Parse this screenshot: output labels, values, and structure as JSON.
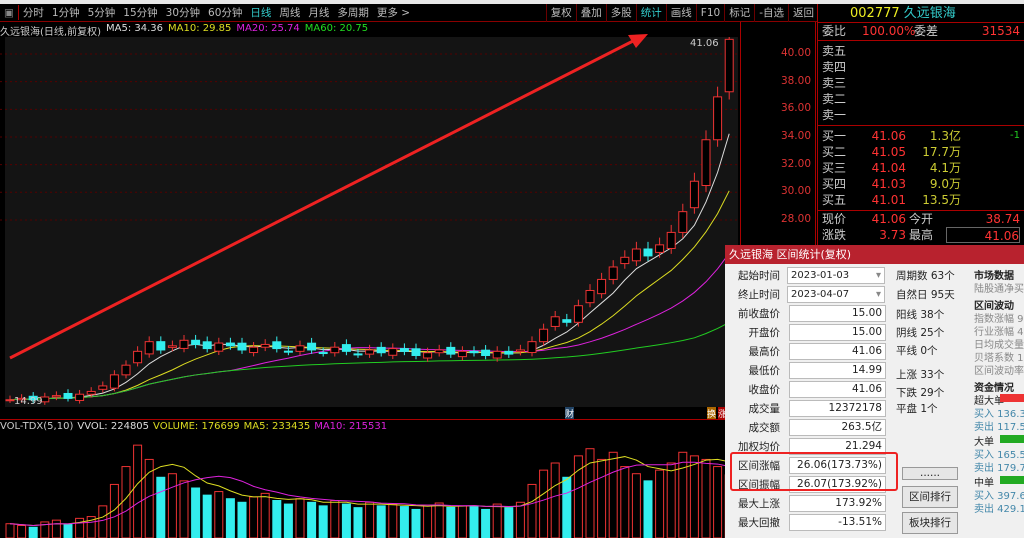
{
  "toolbar": {
    "periods": [
      "分时",
      "1分钟",
      "5分钟",
      "15分钟",
      "30分钟",
      "60分钟",
      "日线",
      "周线",
      "月线",
      "多周期",
      "更多 >"
    ],
    "active": "日线",
    "tools": [
      "复权",
      "叠加",
      "多股",
      "统计",
      "画线",
      "F10",
      "标记",
      "-自选",
      "返回"
    ],
    "active_tool": "统计"
  },
  "info": {
    "title": "久远银海(日线,前复权)",
    "ma5": "MA5: 34.36",
    "ma10": "MA10: 29.85",
    "ma20": "MA20: 25.74",
    "ma60": "MA60: 20.75"
  },
  "axis_ticks": [
    "40.00",
    "38.00",
    "36.00",
    "34.00",
    "32.00",
    "30.00",
    "28.00"
  ],
  "high_label": "41.06",
  "low_label": "14.99",
  "vol_info": {
    "name": "VOL-TDX(5,10)",
    "vvol": "VVOL: 224805",
    "volume": "VOLUME: 176699",
    "ma5": "MA5: 233435",
    "ma10": "MA10: 215531"
  },
  "markers": {
    "cai": "财",
    "jiao": "换",
    "zhang": "涨"
  },
  "chart_data": {
    "type": "candlestick",
    "closes": [
      15.0,
      15.1,
      15.0,
      15.2,
      15.3,
      15.1,
      15.4,
      15.6,
      16.0,
      16.8,
      17.5,
      18.5,
      19.2,
      18.6,
      18.9,
      19.3,
      19.0,
      18.7,
      19.1,
      18.9,
      18.6,
      18.8,
      19.0,
      18.7,
      18.5,
      18.9,
      18.6,
      18.4,
      18.8,
      18.5,
      18.3,
      18.6,
      18.4,
      18.7,
      18.5,
      18.2,
      18.4,
      18.6,
      18.3,
      18.5,
      18.4,
      18.2,
      18.5,
      18.3,
      18.6,
      19.2,
      20.1,
      21.0,
      20.6,
      21.8,
      22.9,
      23.7,
      24.6,
      25.3,
      25.9,
      25.4,
      26.2,
      27.1,
      28.6,
      30.8,
      33.8,
      36.9,
      41.06
    ],
    "ylim": [
      14,
      42
    ],
    "volumes": [
      40,
      35,
      30,
      45,
      50,
      38,
      55,
      60,
      90,
      150,
      200,
      260,
      220,
      170,
      180,
      160,
      140,
      120,
      130,
      110,
      100,
      115,
      125,
      105,
      95,
      110,
      100,
      90,
      105,
      95,
      85,
      100,
      90,
      95,
      88,
      80,
      92,
      98,
      86,
      90,
      88,
      80,
      95,
      85,
      100,
      150,
      190,
      210,
      170,
      230,
      250,
      220,
      240,
      200,
      180,
      160,
      190,
      210,
      240,
      230,
      220,
      200,
      176.7
    ],
    "vmax": 280
  },
  "quote": {
    "code": "002777",
    "name": "久远银海",
    "weibi_label": "委比",
    "weibi": "100.00%",
    "weicha_label": "委差",
    "weicha": "31534",
    "sells": [
      "卖五",
      "卖四",
      "卖三",
      "卖二",
      "卖一"
    ],
    "buys": [
      {
        "l": "买一",
        "p": "41.06",
        "v": "1.3亿",
        "c": "-1"
      },
      {
        "l": "买二",
        "p": "41.05",
        "v": "17.7万"
      },
      {
        "l": "买三",
        "p": "41.04",
        "v": "4.1万"
      },
      {
        "l": "买四",
        "p": "41.03",
        "v": "9.0万"
      },
      {
        "l": "买五",
        "p": "41.01",
        "v": "13.5万"
      }
    ],
    "xianjia_label": "现价",
    "xianjia": "41.06",
    "jinkai_label": "今开",
    "jinkai": "38.74",
    "zhangdie_label": "涨跌",
    "zhangdie": "3.73",
    "zuigao_label": "最高",
    "zuigao": "41.06"
  },
  "dialog": {
    "title": "久远银海 区间统计(复权)",
    "start_label": "起始时间",
    "start": "2023-01-03",
    "end_label": "终止时间",
    "end": "2023-04-07",
    "fields": [
      {
        "l": "前收盘价",
        "v": "15.00"
      },
      {
        "l": "开盘价",
        "v": "15.00"
      },
      {
        "l": "最高价",
        "v": "41.06"
      },
      {
        "l": "最低价",
        "v": "14.99"
      },
      {
        "l": "收盘价",
        "v": "41.06"
      },
      {
        "l": "成交量",
        "v": "12372178"
      },
      {
        "l": "成交额",
        "v": "263.5亿"
      },
      {
        "l": "加权均价",
        "v": "21.294"
      },
      {
        "l": "区间涨幅",
        "v": "26.06(173.73%)"
      },
      {
        "l": "区间振幅",
        "v": "26.07(173.92%)"
      },
      {
        "l": "最大上涨",
        "v": "173.92%"
      },
      {
        "l": "最大回撤",
        "v": "-13.51%"
      }
    ],
    "stats": [
      "周期数 63个",
      "自然日 95天",
      "阳线 38个",
      "阴线 25个",
      "平线 0个",
      "上涨 33个",
      "下跌 29个",
      "平盘 1个"
    ],
    "buttons": [
      "......",
      "区间排行",
      "板块排行"
    ],
    "market": {
      "h1": "市场数据",
      "t1": "陆股通净买",
      "h2": "区间波动",
      "items": [
        "指数涨幅 9",
        "行业涨幅 4",
        "日均成交量",
        "贝塔系数 1.",
        "区间波动率"
      ],
      "h3": "资金情况",
      "funds": [
        {
          "l": "超大单",
          "buy": "买入 136.3",
          "sell": "卖出 117.5",
          "c": "#e33"
        },
        {
          "l": "大单",
          "buy": "买入 165.5",
          "sell": "卖出 179.7",
          "c": "#2a2"
        },
        {
          "l": "中单",
          "buy": "买入 397.6",
          "sell": "卖出 429.1",
          "c": "#2a2"
        }
      ]
    }
  }
}
